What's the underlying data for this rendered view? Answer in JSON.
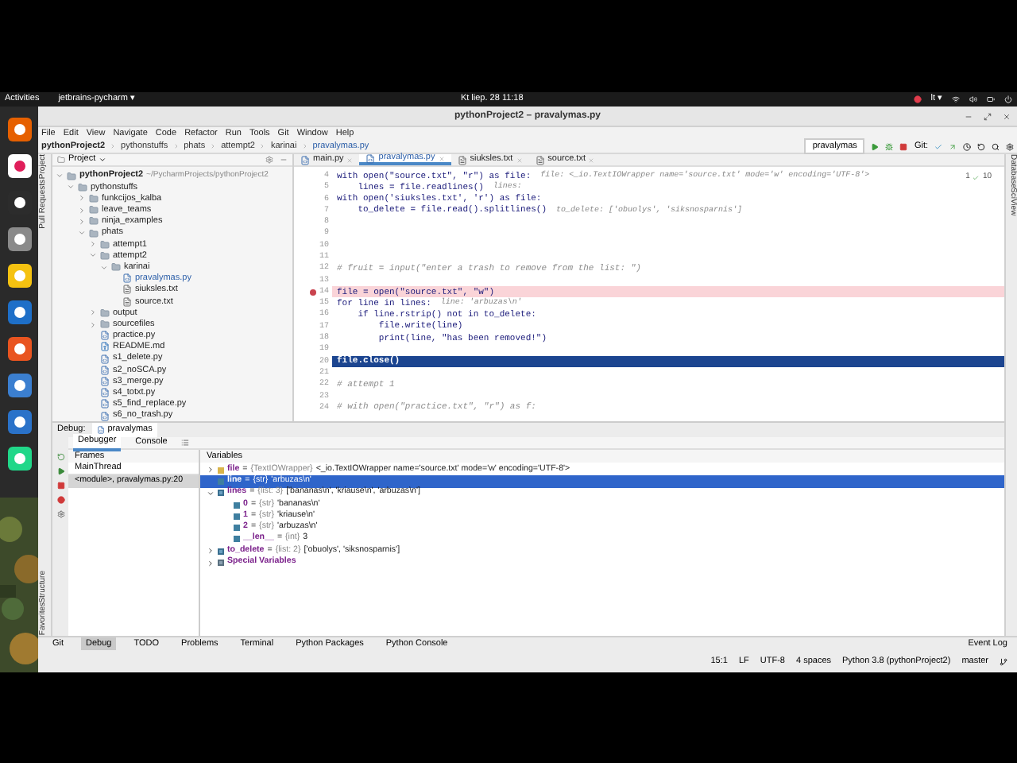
{
  "desktop": {
    "activities": "Activities",
    "app_menu": "jetbrains-pycharm ▾",
    "clock": "Kt liep. 28  11:18",
    "keyboard_layout": "lt ▾",
    "dock": [
      {
        "kind": "firefox"
      },
      {
        "kind": "slack"
      },
      {
        "kind": "terminal"
      },
      {
        "kind": "files"
      },
      {
        "kind": "music"
      },
      {
        "kind": "writer"
      },
      {
        "kind": "software"
      },
      {
        "kind": "help"
      },
      {
        "kind": "store"
      },
      {
        "kind": "pycharm"
      }
    ]
  },
  "window": {
    "title": "pythonProject2 – pravalymas.py",
    "menu": [
      "File",
      "Edit",
      "View",
      "Navigate",
      "Code",
      "Refactor",
      "Run",
      "Tools",
      "Git",
      "Window",
      "Help"
    ],
    "breadcrumb": [
      "pythonProject2",
      "pythonstuffs",
      "phats",
      "attempt2",
      "karinai",
      "pravalymas.py"
    ],
    "run_config": "pravalymas",
    "git_label": "Git:"
  },
  "side_tabs": {
    "left_top": [
      "Project",
      "Pull Requests"
    ],
    "left_bottom": [
      "Structure",
      "Favorites"
    ],
    "right": [
      "Database",
      "SciView"
    ]
  },
  "project_panel": {
    "header": "Project",
    "tree": [
      {
        "name": "pythonProject2",
        "path": "~/PycharmProjects/pythonProject2",
        "kind": "folder",
        "expanded": true,
        "children": [
          {
            "name": "pythonstuffs",
            "kind": "folder",
            "expanded": true,
            "children": [
              {
                "name": "funkcijos_kalba",
                "kind": "folder",
                "expanded": false
              },
              {
                "name": "leave_teams",
                "kind": "folder",
                "expanded": false
              },
              {
                "name": "ninja_examples",
                "kind": "folder",
                "expanded": false
              },
              {
                "name": "phats",
                "kind": "folder",
                "expanded": true,
                "children": [
                  {
                    "name": "attempt1",
                    "kind": "folder",
                    "expanded": false
                  },
                  {
                    "name": "attempt2",
                    "kind": "folder",
                    "expanded": true,
                    "children": [
                      {
                        "name": "karinai",
                        "kind": "folder",
                        "expanded": true,
                        "children": [
                          {
                            "name": "pravalymas.py",
                            "kind": "py"
                          },
                          {
                            "name": "siuksles.txt",
                            "kind": "txt"
                          },
                          {
                            "name": "source.txt",
                            "kind": "txt"
                          }
                        ]
                      }
                    ]
                  },
                  {
                    "name": "output",
                    "kind": "folder",
                    "expanded": false
                  },
                  {
                    "name": "sourcefiles",
                    "kind": "folder",
                    "expanded": false
                  },
                  {
                    "name": "practice.py",
                    "kind": "py"
                  },
                  {
                    "name": "README.md",
                    "kind": "md"
                  },
                  {
                    "name": "s1_delete.py",
                    "kind": "py"
                  },
                  {
                    "name": "s2_noSCA.py",
                    "kind": "py"
                  },
                  {
                    "name": "s3_merge.py",
                    "kind": "py"
                  },
                  {
                    "name": "s4_totxt.py",
                    "kind": "py"
                  },
                  {
                    "name": "s5_find_replace.py",
                    "kind": "py"
                  },
                  {
                    "name": "s6_no_trash.py",
                    "kind": "py"
                  }
                ]
              }
            ]
          }
        ]
      }
    ]
  },
  "editor": {
    "tabs": [
      {
        "label": "main.py",
        "kind": "py",
        "selected": false
      },
      {
        "label": "pravalymas.py",
        "kind": "py",
        "selected": true
      },
      {
        "label": "siuksles.txt",
        "kind": "txt",
        "selected": false
      },
      {
        "label": "source.txt",
        "kind": "txt",
        "selected": false
      }
    ],
    "inspection": {
      "warnings": "1",
      "weak": "10"
    },
    "lines": [
      {
        "number": "4",
        "kind": "code",
        "code": "with open(\"source.txt\", \"r\") as file:",
        "hint": "file: <_io.TextIOWrapper name='source.txt' mode='w' encoding='UTF-8'>"
      },
      {
        "number": "5",
        "kind": "code",
        "code": "    lines = file.readlines()",
        "hint": "lines:"
      },
      {
        "number": "6",
        "kind": "code",
        "code": "with open('siuksles.txt', 'r') as file:"
      },
      {
        "number": "7",
        "kind": "code",
        "code": "    to_delete = file.read().splitlines()",
        "hint": "to_delete: ['obuolys', 'siksnosparnis']"
      },
      {
        "number": "8",
        "kind": "blank"
      },
      {
        "number": "9",
        "kind": "blank"
      },
      {
        "number": "10",
        "kind": "blank"
      },
      {
        "number": "11",
        "kind": "blank"
      },
      {
        "number": "12",
        "kind": "comment",
        "code": "# fruit = input(\"enter a trash to remove from the list: \")"
      },
      {
        "number": "13",
        "kind": "blank"
      },
      {
        "number": "14",
        "kind": "breakpoint",
        "code": "file = open(\"source.txt\", \"w\")"
      },
      {
        "number": "15",
        "kind": "code",
        "code": "for line in lines:",
        "hint": "line: 'arbuzas\\n'"
      },
      {
        "number": "16",
        "kind": "code",
        "code": "    if line.rstrip() not in to_delete:"
      },
      {
        "number": "17",
        "kind": "code",
        "code": "        file.write(line)"
      },
      {
        "number": "18",
        "kind": "code",
        "code": "        print(line, \"has been removed!\")"
      },
      {
        "number": "19",
        "kind": "blank"
      },
      {
        "number": "20",
        "kind": "current",
        "code": "file.close()"
      },
      {
        "number": "21",
        "kind": "blank"
      },
      {
        "number": "22",
        "kind": "comment",
        "code": "# attempt 1"
      },
      {
        "number": "23",
        "kind": "blank"
      },
      {
        "number": "24",
        "kind": "comment",
        "code": "# with open(\"practice.txt\", \"r\") as f:"
      }
    ]
  },
  "debug": {
    "title": "Debug:",
    "tab": "pravalymas",
    "subtabs": [
      {
        "label": "Debugger",
        "selected": true
      },
      {
        "label": "Console",
        "selected": false
      }
    ],
    "assign": "=",
    "frames_header": "Frames",
    "thread": "MainThread",
    "frames": [
      {
        "label": "<module>, pravalymas.py:20",
        "selected": true
      }
    ],
    "variables_header": "Variables",
    "variables": [
      {
        "name": "file",
        "type": "{TextIOWrapper}",
        "value": "<_io.TextIOWrapper name='source.txt' mode='w' encoding='UTF-8'>",
        "kind": "object",
        "expanded": false,
        "selected": false
      },
      {
        "name": "line",
        "type": "{str}",
        "value": "'arbuzas\\n'",
        "kind": "value",
        "selected": true
      },
      {
        "name": "lines",
        "type": "{list: 3}",
        "value": "['bananas\\n', 'kriause\\n', 'arbuzas\\n']",
        "kind": "list",
        "expanded": true,
        "selected": false,
        "children": [
          {
            "name": "0",
            "type": "{str}",
            "value": "'bananas\\n'",
            "kind": "value",
            "selected": false
          },
          {
            "name": "1",
            "type": "{str}",
            "value": "'kriause\\n'",
            "kind": "value",
            "selected": false
          },
          {
            "name": "2",
            "type": "{str}",
            "value": "'arbuzas\\n'",
            "kind": "value",
            "selected": false
          },
          {
            "name": "__len__",
            "type": "{int}",
            "value": "3",
            "kind": "value",
            "selected": false
          }
        ]
      },
      {
        "name": "to_delete",
        "type": "{list: 2}",
        "value": "['obuolys', 'siksnosparnis']",
        "kind": "list",
        "expanded": false,
        "selected": false
      },
      {
        "name": "Special Variables",
        "kind": "special",
        "expanded": false,
        "selected": false
      }
    ]
  },
  "tool_windows": [
    {
      "label": "Git",
      "selected": false
    },
    {
      "label": "Debug",
      "selected": true
    },
    {
      "label": "TODO",
      "selected": false
    },
    {
      "label": "Problems",
      "selected": false
    },
    {
      "label": "Terminal",
      "selected": false
    },
    {
      "label": "Python Packages",
      "selected": false
    },
    {
      "label": "Python Console",
      "selected": false
    }
  ],
  "event_log": "Event Log",
  "status": [
    "15:1",
    "LF",
    "UTF-8",
    "4 spaces",
    "Python 3.8 (pythonProject2)",
    "master"
  ]
}
